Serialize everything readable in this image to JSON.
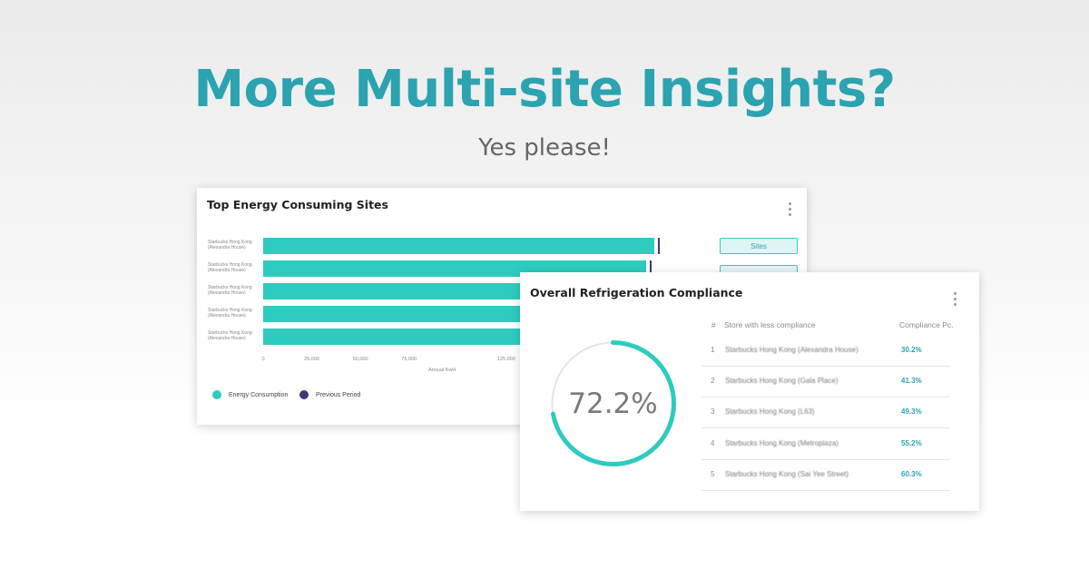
{
  "hero": {
    "headline": "More Multi-site Insights?",
    "subline": "Yes please!"
  },
  "colors": {
    "accent": "#2ba3b0",
    "bar": "#2ecbbf",
    "previous_period": "#3c3c72",
    "donut_track": "#e5e5e5"
  },
  "energy_card": {
    "title": "Top Energy Consuming Sites",
    "sites_button": "Sites",
    "sites": [
      "Starbucks Hong Kong (Alexandra House)",
      "Starbucks Hong Kong (Alexandra House)",
      "Starbucks Hong Kong (Alexandra House)",
      "Starbucks Hong Kong (Alexandra House)",
      "Starbucks Hong Kong (Alexandra House)"
    ],
    "x_ticks": [
      "0",
      "25,000",
      "50,000",
      "75,000",
      "125,000"
    ],
    "xlabel": "Annual KwH",
    "legend": [
      "Energy Consumption",
      "Previous Period"
    ]
  },
  "chart_data": {
    "type": "bar",
    "orientation": "horizontal",
    "xlabel": "Annual KwH",
    "categories": [
      "Starbucks Hong Kong (Alexandra House)",
      "Starbucks Hong Kong (Alexandra House)",
      "Starbucks Hong Kong (Alexandra House)",
      "Starbucks Hong Kong (Alexandra House)",
      "Starbucks Hong Kong (Alexandra House)"
    ],
    "series": [
      {
        "name": "Energy Consumption",
        "values": [
          201000,
          197000,
          186000,
          186000,
          186000
        ]
      },
      {
        "name": "Previous Period",
        "values": [
          203000,
          199000,
          null,
          null,
          null
        ]
      }
    ],
    "ticks": [
      0,
      25000,
      50000,
      75000,
      125000
    ],
    "xlim": [
      0,
      210000
    ]
  },
  "compliance_card": {
    "title": "Overall Refrigeration  Compliance",
    "percent": 72.2,
    "percent_label": "72.2%",
    "columns": [
      "#",
      "Store  with less compliance",
      "Compliance Pc."
    ],
    "rows": [
      {
        "num": "1",
        "store": "Starbucks Hong Kong (Alexandra House)",
        "pct": "30.2%"
      },
      {
        "num": "2",
        "store": "Starbucks Hong Kong (Gala Place)",
        "pct": "41.3%"
      },
      {
        "num": "3",
        "store": "Starbucks Hong Kong (L63)",
        "pct": "49.3%"
      },
      {
        "num": "4",
        "store": "Starbucks Hong Kong (Metroplaza)",
        "pct": "55.2%"
      },
      {
        "num": "5",
        "store": "Starbucks Hong Kong (Sai Yee Street)",
        "pct": "60.3%"
      }
    ]
  }
}
